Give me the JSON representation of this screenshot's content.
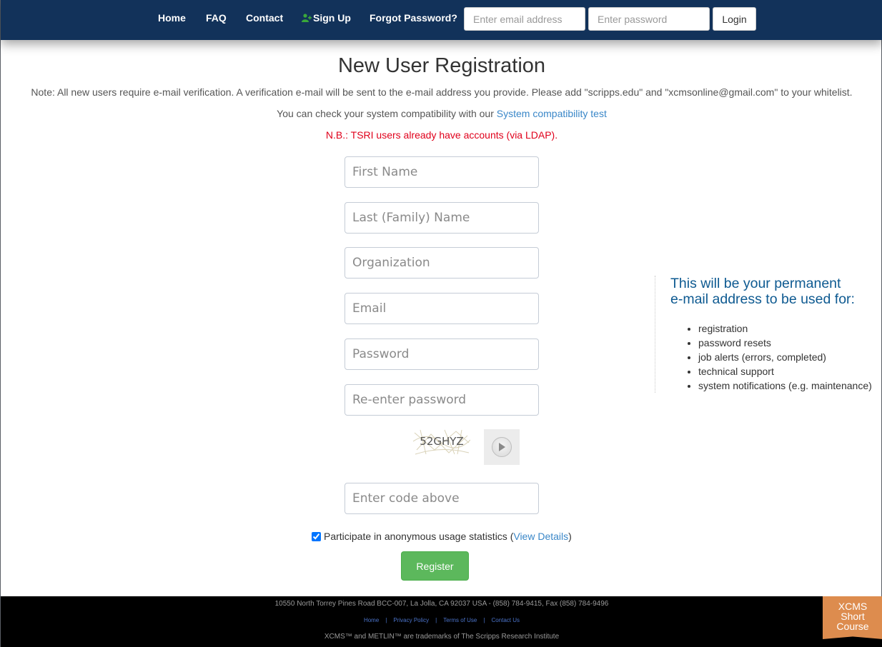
{
  "nav": {
    "links": [
      {
        "label": "Home"
      },
      {
        "label": "FAQ"
      },
      {
        "label": "Contact"
      },
      {
        "label": "Sign Up",
        "icon": "user-plus-icon",
        "icon_color": "#3aa83a"
      },
      {
        "label": "Forgot Password?"
      }
    ],
    "email_placeholder": "Enter email address",
    "password_placeholder": "Enter password",
    "login_label": "Login",
    "background": "#12325a"
  },
  "page": {
    "title": "New User Registration",
    "note": "Note: All new users require e-mail verification. A verification e-mail will be sent to the e-mail address you provide. Please add \"scripps.edu\" and \"xcmsonline@gmail.com\" to your whitelist.",
    "compat_prefix": "You can check your system compatibility with our ",
    "compat_link": "System compatibility test",
    "tsri_note": "N.B.: TSRI users already have accounts (via LDAP)."
  },
  "form": {
    "first_name_placeholder": "First Name",
    "last_name_placeholder": "Last (Family) Name",
    "organization_placeholder": "Organization",
    "email_placeholder": "Email",
    "password_placeholder": "Password",
    "reenter_password_placeholder": "Re-enter password",
    "captcha_text": "52GHYZ",
    "captcha_code_placeholder": "Enter code above",
    "consent_checked": true,
    "consent_label": "Participate in anonymous usage statistics (",
    "consent_link": "View Details",
    "consent_suffix": ")",
    "register_label": "Register",
    "register_color": "#5cb85c"
  },
  "info_panel": {
    "heading_line1": "This will be your permanent",
    "heading_line2": "e-mail address to be used for:",
    "items": [
      "registration",
      "password resets",
      "job alerts (errors, completed)",
      "technical support",
      "system notifications (e.g. maintenance)"
    ]
  },
  "footer": {
    "address": "10550 North Torrey Pines Road BCC-007, La Jolla, CA 92037 USA - (858) 784-9415, Fax (858) 784-9496",
    "links": [
      "Home",
      "Privacy Policy",
      "Terms of Use",
      "Contact Us"
    ],
    "trademark": "XCMS™ and METLIN™ are trademarks of The Scripps Research Institute"
  },
  "ribbon": {
    "line1": "XCMS",
    "line2": "Short",
    "line3": "Course",
    "color": "#dd8c4e"
  }
}
